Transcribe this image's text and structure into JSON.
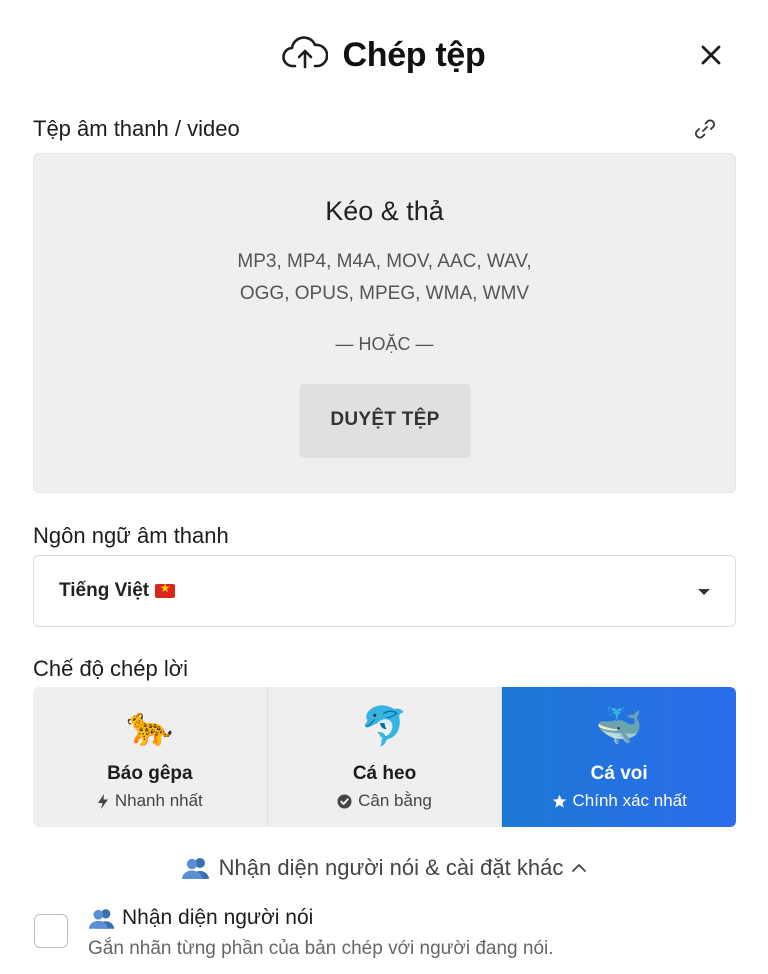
{
  "header": {
    "title": "Chép tệp",
    "upload_icon": "cloud-upload-icon",
    "close_icon": "close-icon"
  },
  "file_section": {
    "label": "Tệp âm thanh / video",
    "link_icon": "link-icon",
    "dropzone": {
      "title": "Kéo & thả",
      "formats_line1": "MP3, MP4, M4A, MOV, AAC, WAV,",
      "formats_line2": "OGG, OPUS, MPEG, WMA, WMV",
      "or_text": "— HOẶC —",
      "browse_label": "DUYỆT TỆP"
    }
  },
  "language": {
    "label": "Ngôn ngữ âm thanh",
    "selected": "Tiếng Việt"
  },
  "mode": {
    "label": "Chế độ chép lời",
    "options": [
      {
        "emoji": "🐆",
        "name": "Báo gêpa",
        "icon": "bolt-icon",
        "subtitle": "Nhanh nhất"
      },
      {
        "emoji": "🐬",
        "name": "Cá heo",
        "icon": "check-circle-icon",
        "subtitle": "Cân bằng"
      },
      {
        "emoji": "🐳",
        "name": "Cá voi",
        "icon": "star-icon",
        "subtitle": "Chính xác nhất"
      }
    ],
    "selected_index": 2,
    "active_color": "#2b6cec"
  },
  "advanced": {
    "toggle_label": "Nhận diện người nói & cài đặt khác",
    "expanded": true
  },
  "speaker": {
    "title": "Nhận diện người nói",
    "description": "Gắn nhãn từng phần của bản chép với người đang nói.",
    "checked": false
  }
}
